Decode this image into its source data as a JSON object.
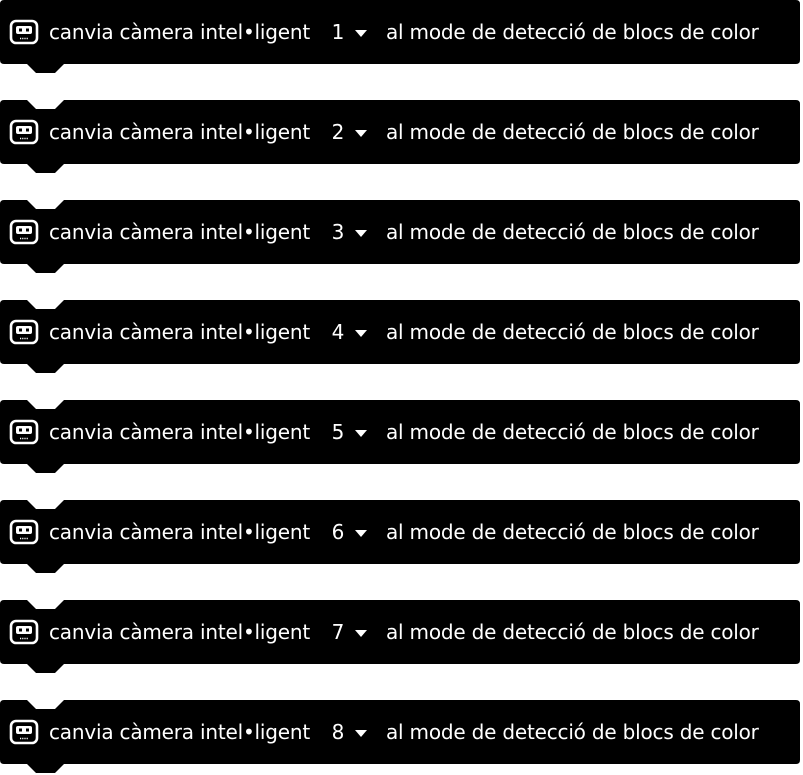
{
  "colors": {
    "block_fill": "#000000",
    "text": "#ffffff",
    "background": "#ffffff"
  },
  "icon": "smart-camera-icon",
  "blocks": [
    {
      "prefix": "canvia càmera intel•ligent",
      "camera": "1",
      "suffix": "al mode de detecció de blocs de color"
    },
    {
      "prefix": "canvia càmera intel•ligent",
      "camera": "2",
      "suffix": "al mode de detecció de blocs de color"
    },
    {
      "prefix": "canvia càmera intel•ligent",
      "camera": "3",
      "suffix": "al mode de detecció de blocs de color"
    },
    {
      "prefix": "canvia càmera intel•ligent",
      "camera": "4",
      "suffix": "al mode de detecció de blocs de color"
    },
    {
      "prefix": "canvia càmera intel•ligent",
      "camera": "5",
      "suffix": "al mode de detecció de blocs de color"
    },
    {
      "prefix": "canvia càmera intel•ligent",
      "camera": "6",
      "suffix": "al mode de detecció de blocs de color"
    },
    {
      "prefix": "canvia càmera intel•ligent",
      "camera": "7",
      "suffix": "al mode de detecció de blocs de color"
    },
    {
      "prefix": "canvia càmera intel•ligent",
      "camera": "8",
      "suffix": "al mode de detecció de blocs de color"
    }
  ]
}
